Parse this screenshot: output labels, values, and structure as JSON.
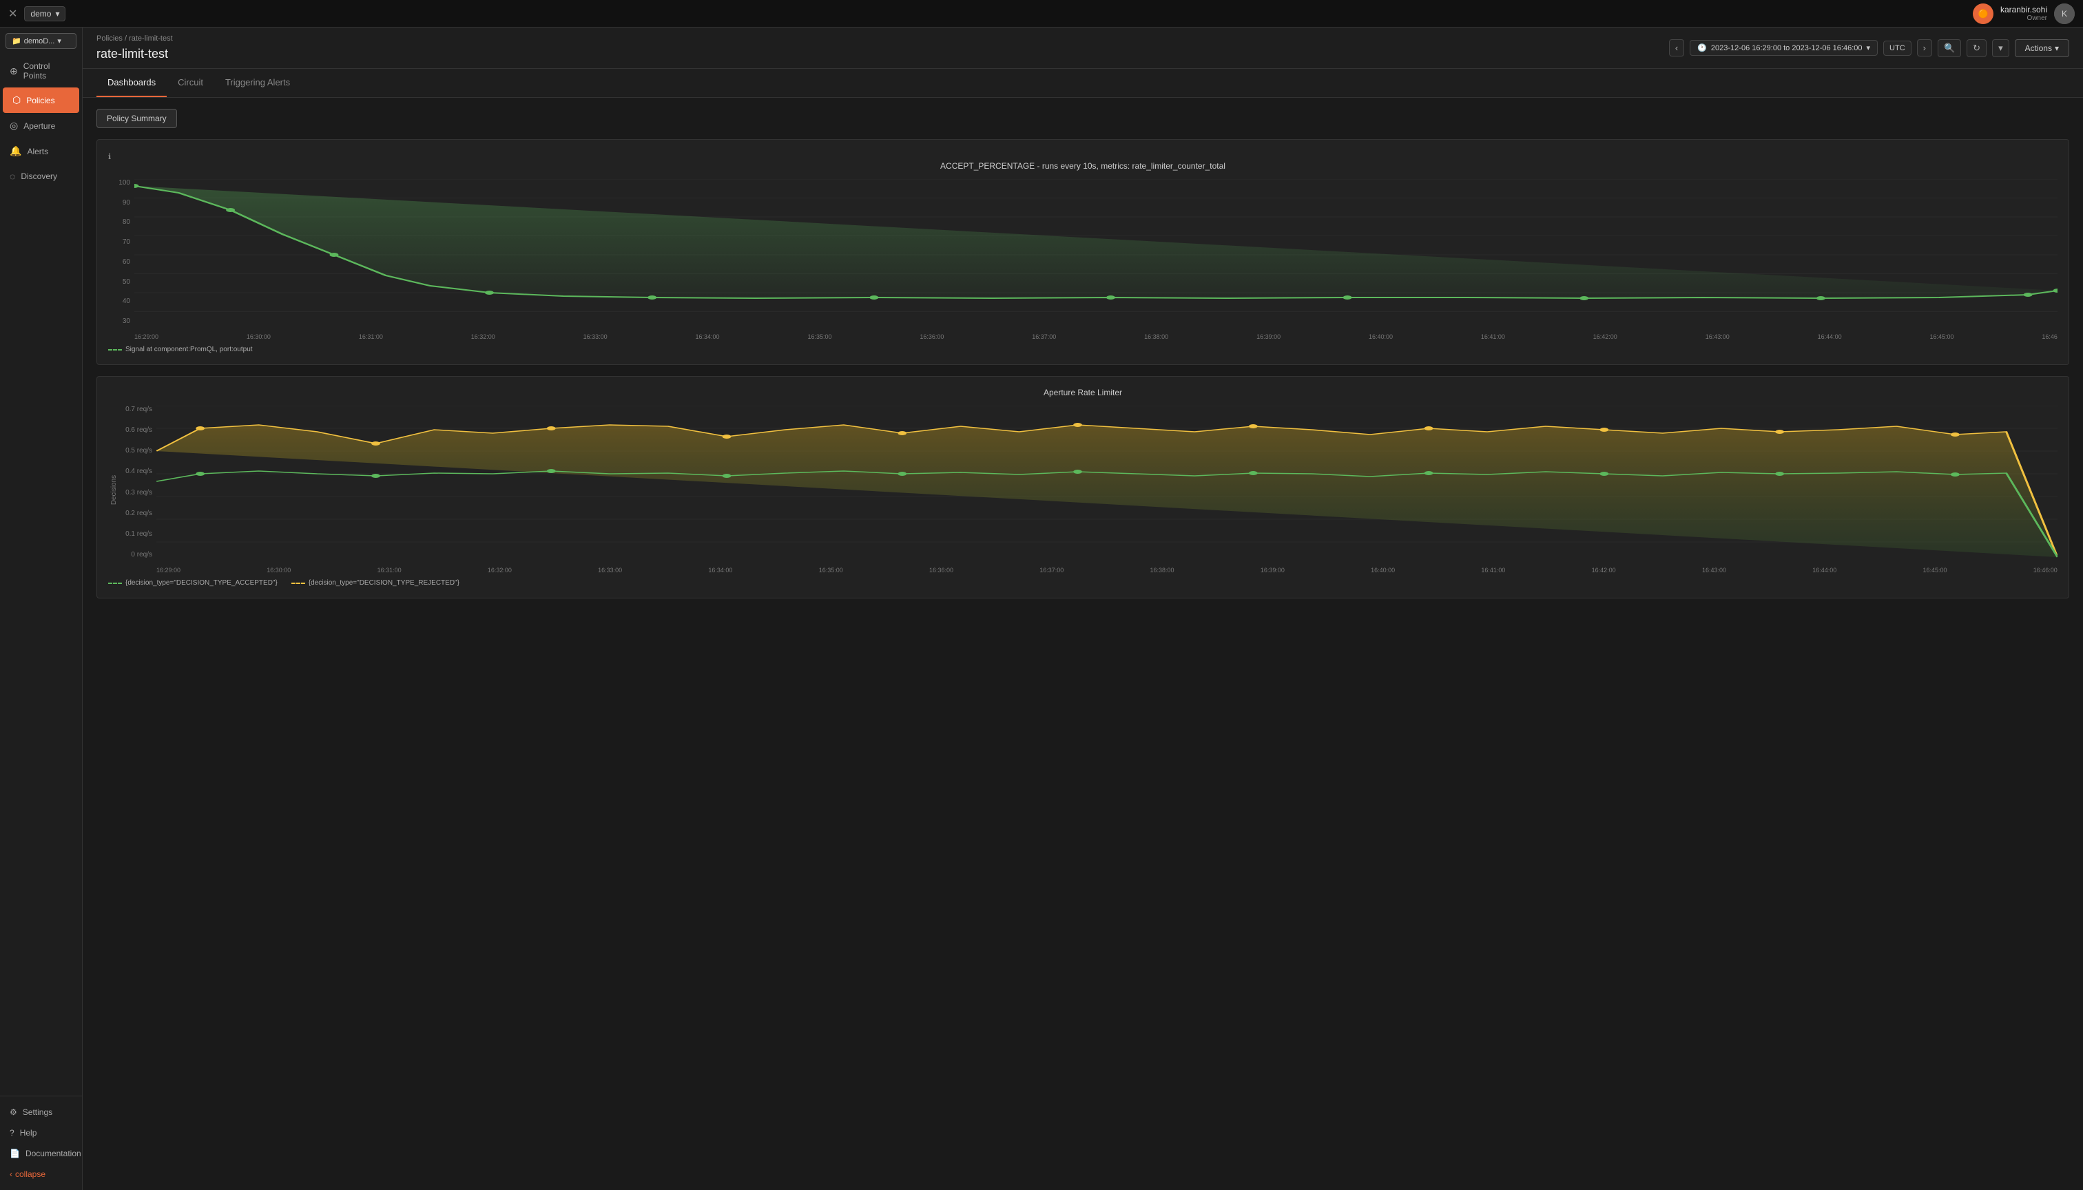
{
  "topbar": {
    "workspace": "demo",
    "close_icon": "✕",
    "chevron": "▾",
    "user": {
      "name": "karanbir.sohi",
      "role": "Owner"
    }
  },
  "sidebar": {
    "workspace_label": "demoD...",
    "items": [
      {
        "id": "control-points",
        "label": "Control Points",
        "icon": "⊕"
      },
      {
        "id": "policies",
        "label": "Policies",
        "icon": "⬡",
        "active": true
      },
      {
        "id": "aperture",
        "label": "Aperture",
        "icon": "◎"
      },
      {
        "id": "alerts",
        "label": "Alerts",
        "icon": "🔔"
      },
      {
        "id": "discovery",
        "label": "Discovery",
        "icon": "◌"
      }
    ],
    "bottom_items": [
      {
        "id": "settings",
        "label": "Settings",
        "icon": "⚙"
      },
      {
        "id": "help",
        "label": "Help",
        "icon": "?"
      },
      {
        "id": "documentation",
        "label": "Documentation",
        "icon": "📄"
      }
    ],
    "collapse_label": "collapse"
  },
  "header": {
    "breadcrumb": {
      "parent": "Policies",
      "separator": "/",
      "current": "rate-limit-test"
    },
    "title": "rate-limit-test",
    "time_range": "2023-12-06 16:29:00 to 2023-12-06 16:46:00",
    "timezone": "UTC",
    "actions_label": "Actions"
  },
  "tabs": [
    {
      "id": "dashboards",
      "label": "Dashboards",
      "active": true
    },
    {
      "id": "circuit",
      "label": "Circuit"
    },
    {
      "id": "triggering-alerts",
      "label": "Triggering Alerts"
    }
  ],
  "policy_summary_btn": "Policy Summary",
  "chart1": {
    "title": "ACCEPT_PERCENTAGE - runs every 10s, metrics: rate_limiter_counter_total",
    "y_axis": [
      "100",
      "90",
      "80",
      "70",
      "60",
      "50",
      "40",
      "30"
    ],
    "x_axis": [
      "16:29:00",
      "16:30:00",
      "16:31:00",
      "16:32:00",
      "16:33:00",
      "16:34:00",
      "16:35:00",
      "16:36:00",
      "16:37:00",
      "16:38:00",
      "16:39:00",
      "16:40:00",
      "16:41:00",
      "16:42:00",
      "16:43:00",
      "16:44:00",
      "16:45:00",
      "16:46"
    ],
    "legend": "Signal at component:PromQL, port:output"
  },
  "chart2": {
    "title": "Aperture Rate Limiter",
    "y_axis": [
      "0.7 req/s",
      "0.6 req/s",
      "0.5 req/s",
      "0.4 req/s",
      "0.3 req/s",
      "0.2 req/s",
      "0.1 req/s",
      "0 req/s"
    ],
    "y_axis_label": "Decisions",
    "x_axis": [
      "16:29:00",
      "16:30:00",
      "16:31:00",
      "16:32:00",
      "16:33:00",
      "16:34:00",
      "16:35:00",
      "16:36:00",
      "16:37:00",
      "16:38:00",
      "16:39:00",
      "16:40:00",
      "16:41:00",
      "16:42:00",
      "16:43:00",
      "16:44:00",
      "16:45:00",
      "16:46:00"
    ],
    "legend_accepted": "{decision_type=\"DECISION_TYPE_ACCEPTED\"}",
    "legend_rejected": "{decision_type=\"DECISION_TYPE_REJECTED\"}"
  }
}
